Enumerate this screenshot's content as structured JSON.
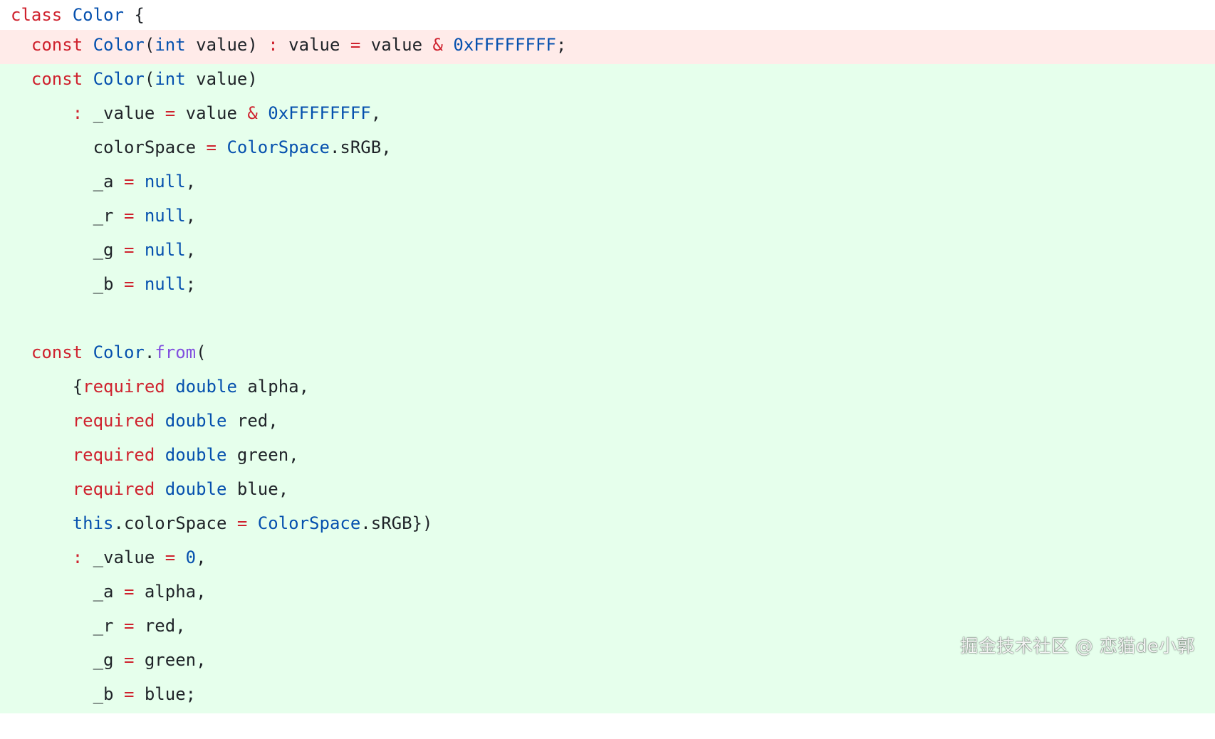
{
  "code": {
    "lines": [
      {
        "state": "plain",
        "tokens": [
          [
            "keyword",
            "class"
          ],
          [
            "plain",
            " "
          ],
          [
            "type2",
            "Color"
          ],
          [
            "plain",
            " {"
          ]
        ]
      },
      {
        "state": "removed",
        "tokens": [
          [
            "plain",
            "  "
          ],
          [
            "keyword",
            "const"
          ],
          [
            "plain",
            " "
          ],
          [
            "type2",
            "Color"
          ],
          [
            "plain",
            "("
          ],
          [
            "type2",
            "int"
          ],
          [
            "plain",
            " value) "
          ],
          [
            "op",
            ":"
          ],
          [
            "plain",
            " value "
          ],
          [
            "op",
            "="
          ],
          [
            "plain",
            " value "
          ],
          [
            "op",
            "&"
          ],
          [
            "plain",
            " "
          ],
          [
            "number",
            "0xFFFFFFFF"
          ],
          [
            "plain",
            ";"
          ]
        ]
      },
      {
        "state": "added",
        "tokens": [
          [
            "plain",
            "  "
          ],
          [
            "keyword",
            "const"
          ],
          [
            "plain",
            " "
          ],
          [
            "type2",
            "Color"
          ],
          [
            "plain",
            "("
          ],
          [
            "type2",
            "int"
          ],
          [
            "plain",
            " value)"
          ]
        ]
      },
      {
        "state": "added",
        "tokens": [
          [
            "plain",
            "      "
          ],
          [
            "op",
            ":"
          ],
          [
            "plain",
            " _value "
          ],
          [
            "op",
            "="
          ],
          [
            "plain",
            " value "
          ],
          [
            "op",
            "&"
          ],
          [
            "plain",
            " "
          ],
          [
            "number",
            "0xFFFFFFFF"
          ],
          [
            "plain",
            ","
          ]
        ]
      },
      {
        "state": "added",
        "tokens": [
          [
            "plain",
            "        colorSpace "
          ],
          [
            "op",
            "="
          ],
          [
            "plain",
            " "
          ],
          [
            "type2",
            "ColorSpace"
          ],
          [
            "plain",
            ".sRGB,"
          ]
        ]
      },
      {
        "state": "added",
        "tokens": [
          [
            "plain",
            "        _a "
          ],
          [
            "op",
            "="
          ],
          [
            "plain",
            " "
          ],
          [
            "type2",
            "null"
          ],
          [
            "plain",
            ","
          ]
        ]
      },
      {
        "state": "added",
        "tokens": [
          [
            "plain",
            "        _r "
          ],
          [
            "op",
            "="
          ],
          [
            "plain",
            " "
          ],
          [
            "type2",
            "null"
          ],
          [
            "plain",
            ","
          ]
        ]
      },
      {
        "state": "added",
        "tokens": [
          [
            "plain",
            "        _g "
          ],
          [
            "op",
            "="
          ],
          [
            "plain",
            " "
          ],
          [
            "type2",
            "null"
          ],
          [
            "plain",
            ","
          ]
        ]
      },
      {
        "state": "added",
        "tokens": [
          [
            "plain",
            "        _b "
          ],
          [
            "op",
            "="
          ],
          [
            "plain",
            " "
          ],
          [
            "type2",
            "null"
          ],
          [
            "plain",
            ";"
          ]
        ]
      },
      {
        "state": "added",
        "tokens": [
          [
            "plain",
            " "
          ]
        ]
      },
      {
        "state": "added",
        "tokens": [
          [
            "plain",
            "  "
          ],
          [
            "keyword",
            "const"
          ],
          [
            "plain",
            " "
          ],
          [
            "type2",
            "Color"
          ],
          [
            "plain",
            "."
          ],
          [
            "method",
            "from"
          ],
          [
            "plain",
            "("
          ]
        ]
      },
      {
        "state": "added",
        "tokens": [
          [
            "plain",
            "      {"
          ],
          [
            "keyword",
            "required"
          ],
          [
            "plain",
            " "
          ],
          [
            "type2",
            "double"
          ],
          [
            "plain",
            " alpha,"
          ]
        ]
      },
      {
        "state": "added",
        "tokens": [
          [
            "plain",
            "      "
          ],
          [
            "keyword",
            "required"
          ],
          [
            "plain",
            " "
          ],
          [
            "type2",
            "double"
          ],
          [
            "plain",
            " red,"
          ]
        ]
      },
      {
        "state": "added",
        "tokens": [
          [
            "plain",
            "      "
          ],
          [
            "keyword",
            "required"
          ],
          [
            "plain",
            " "
          ],
          [
            "type2",
            "double"
          ],
          [
            "plain",
            " green,"
          ]
        ]
      },
      {
        "state": "added",
        "tokens": [
          [
            "plain",
            "      "
          ],
          [
            "keyword",
            "required"
          ],
          [
            "plain",
            " "
          ],
          [
            "type2",
            "double"
          ],
          [
            "plain",
            " blue,"
          ]
        ]
      },
      {
        "state": "added",
        "tokens": [
          [
            "plain",
            "      "
          ],
          [
            "type2",
            "this"
          ],
          [
            "plain",
            ".colorSpace "
          ],
          [
            "op",
            "="
          ],
          [
            "plain",
            " "
          ],
          [
            "type2",
            "ColorSpace"
          ],
          [
            "plain",
            ".sRGB})"
          ]
        ]
      },
      {
        "state": "added",
        "tokens": [
          [
            "plain",
            "      "
          ],
          [
            "op",
            ":"
          ],
          [
            "plain",
            " _value "
          ],
          [
            "op",
            "="
          ],
          [
            "plain",
            " "
          ],
          [
            "number",
            "0"
          ],
          [
            "plain",
            ","
          ]
        ]
      },
      {
        "state": "added",
        "tokens": [
          [
            "plain",
            "        _a "
          ],
          [
            "op",
            "="
          ],
          [
            "plain",
            " alpha,"
          ]
        ]
      },
      {
        "state": "added",
        "tokens": [
          [
            "plain",
            "        _r "
          ],
          [
            "op",
            "="
          ],
          [
            "plain",
            " red,"
          ]
        ]
      },
      {
        "state": "added",
        "tokens": [
          [
            "plain",
            "        _g "
          ],
          [
            "op",
            "="
          ],
          [
            "plain",
            " green,"
          ]
        ]
      },
      {
        "state": "added",
        "tokens": [
          [
            "plain",
            "        _b "
          ],
          [
            "op",
            "="
          ],
          [
            "plain",
            " blue;"
          ]
        ]
      }
    ]
  },
  "watermark": {
    "text": "掘金技术社区 @ 恋猫de小郭"
  }
}
